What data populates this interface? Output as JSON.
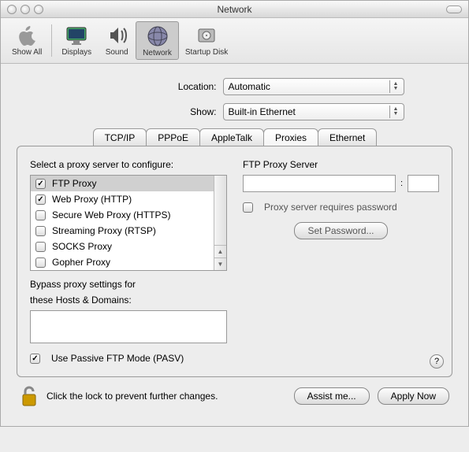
{
  "window": {
    "title": "Network"
  },
  "toolbar": {
    "items": [
      {
        "label": "Show All"
      },
      {
        "label": "Displays"
      },
      {
        "label": "Sound"
      },
      {
        "label": "Network"
      },
      {
        "label": "Startup Disk"
      }
    ]
  },
  "location": {
    "label": "Location:",
    "value": "Automatic"
  },
  "show": {
    "label": "Show:",
    "value": "Built-in Ethernet"
  },
  "tabs": {
    "items": [
      {
        "label": "TCP/IP"
      },
      {
        "label": "PPPoE"
      },
      {
        "label": "AppleTalk"
      },
      {
        "label": "Proxies"
      },
      {
        "label": "Ethernet"
      }
    ],
    "active": 3
  },
  "proxies": {
    "list_label": "Select a proxy server to configure:",
    "items": [
      {
        "label": "FTP Proxy",
        "checked": true,
        "selected": true
      },
      {
        "label": "Web Proxy (HTTP)",
        "checked": true,
        "selected": false
      },
      {
        "label": "Secure Web Proxy (HTTPS)",
        "checked": false,
        "selected": false
      },
      {
        "label": "Streaming Proxy (RTSP)",
        "checked": false,
        "selected": false
      },
      {
        "label": "SOCKS Proxy",
        "checked": false,
        "selected": false
      },
      {
        "label": "Gopher Proxy",
        "checked": false,
        "selected": false
      }
    ],
    "server_label": "FTP Proxy Server",
    "host": "",
    "port_sep": ":",
    "port": "",
    "requires_password_label": "Proxy server requires password",
    "requires_password": false,
    "set_password_label": "Set Password...",
    "bypass_label1": "Bypass proxy settings for",
    "bypass_label2": "these Hosts & Domains:",
    "bypass_value": "",
    "pasv_label": "Use Passive FTP Mode (PASV)",
    "pasv_checked": true,
    "help": "?"
  },
  "footer": {
    "lock_text": "Click the lock to prevent further changes.",
    "assist": "Assist me...",
    "apply": "Apply Now"
  }
}
